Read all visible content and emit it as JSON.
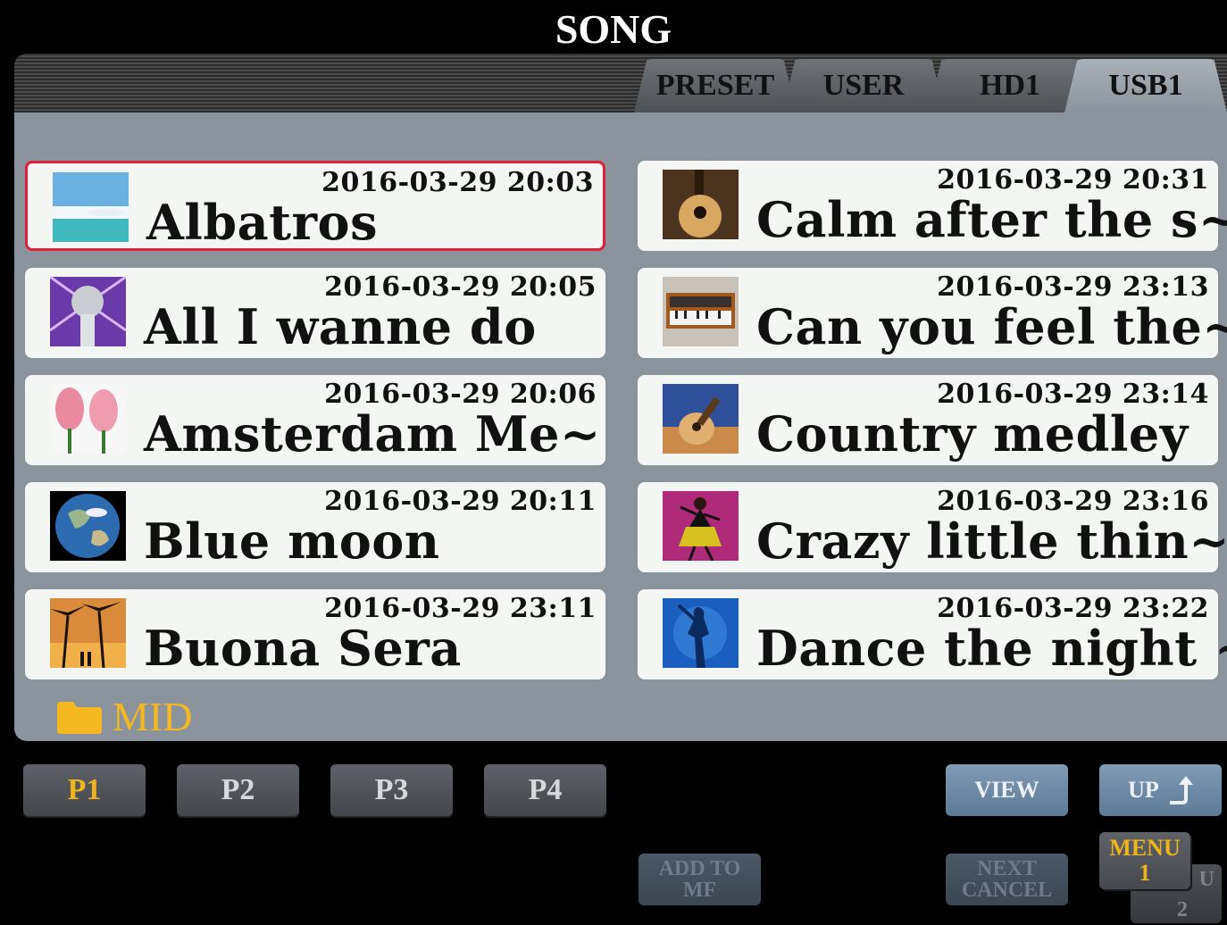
{
  "header": {
    "title": "SONG"
  },
  "tabs": [
    {
      "label": "PRESET",
      "active": false
    },
    {
      "label": "USER",
      "active": false
    },
    {
      "label": "HD1",
      "active": false
    },
    {
      "label": "USB1",
      "active": true
    }
  ],
  "songs": [
    {
      "name": "Albatros",
      "date": "2016-03-29 20:03",
      "thumb": "ocean-beach",
      "selected": true
    },
    {
      "name": "All I wanne do",
      "date": "2016-03-29 20:05",
      "thumb": "microphone",
      "selected": false
    },
    {
      "name": "Amsterdam Me~",
      "date": "2016-03-29 20:06",
      "thumb": "tulips",
      "selected": false
    },
    {
      "name": "Blue moon",
      "date": "2016-03-29 20:11",
      "thumb": "earth",
      "selected": false
    },
    {
      "name": "Buona Sera",
      "date": "2016-03-29 23:11",
      "thumb": "palm-sunset",
      "selected": false
    },
    {
      "name": "Calm after the s~",
      "date": "2016-03-29 20:31",
      "thumb": "acoustic-guitar",
      "selected": false
    },
    {
      "name": "Can you feel the~",
      "date": "2016-03-29 23:13",
      "thumb": "synthesizer",
      "selected": false
    },
    {
      "name": "Country medley",
      "date": "2016-03-29 23:14",
      "thumb": "guitar-sky",
      "selected": false
    },
    {
      "name": "Crazy little thin~",
      "date": "2016-03-29 23:16",
      "thumb": "dancer",
      "selected": false
    },
    {
      "name": "Dance the night ~",
      "date": "2016-03-29 23:22",
      "thumb": "dancer-silhouette",
      "selected": false
    }
  ],
  "folder": {
    "label": "MID",
    "icon": "folder-icon",
    "color": "#f5b820"
  },
  "pages": [
    {
      "label": "P1",
      "active": true
    },
    {
      "label": "P2",
      "active": false
    },
    {
      "label": "P3",
      "active": false
    },
    {
      "label": "P4",
      "active": false
    }
  ],
  "controls": {
    "view": "VIEW",
    "up": "UP",
    "add_to_mf_line1": "ADD TO",
    "add_to_mf_line2": "MF",
    "next": "NEXT",
    "cancel": "CANCEL",
    "menu1_label": "MENU",
    "menu1_num": "1",
    "menu2_letter": "U",
    "menu2_num": "2"
  },
  "colors": {
    "selection": "#e0203a",
    "accent": "#f0b41c",
    "panel": "#8b939c"
  }
}
